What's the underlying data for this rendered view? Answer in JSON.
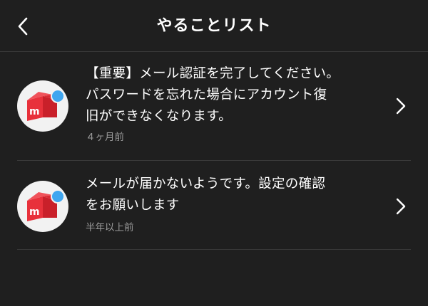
{
  "header": {
    "title": "やることリスト",
    "back_icon": "chevron-left-icon"
  },
  "colors": {
    "background": "#1f1f1f",
    "text": "#ffffff",
    "subtext": "#9a9a9a",
    "divider": "#3a3a3a",
    "brand_red": "#e8313b",
    "unread_dot": "#3fa6f0"
  },
  "todos": [
    {
      "icon": "mercari-box-icon",
      "unread": true,
      "message": "【重要】メール認証を完了してください。\nパスワードを忘れた場合にアカウント復\n旧ができなくなります。",
      "time": "４ヶ月前"
    },
    {
      "icon": "mercari-box-icon",
      "unread": true,
      "message": "メールが届かないようです。設定の確認\nをお願いします",
      "time": "半年以上前"
    }
  ]
}
